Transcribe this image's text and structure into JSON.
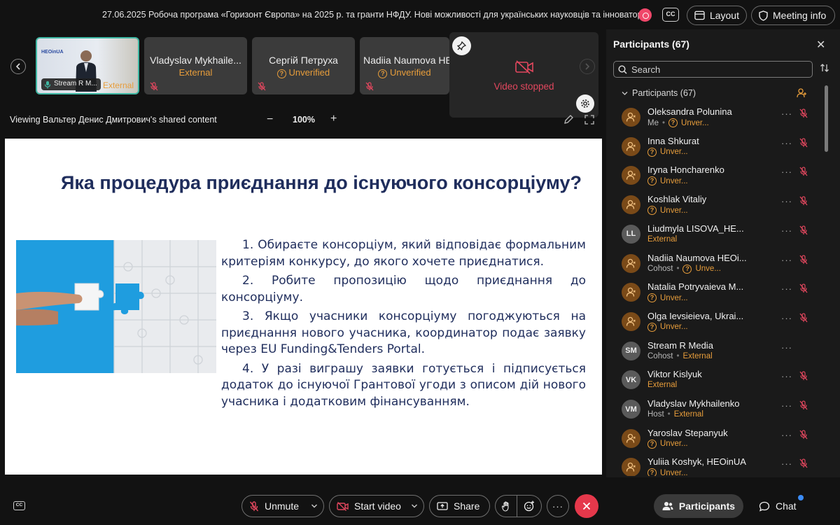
{
  "meeting": {
    "title": "27.06.2025 Робоча програма «Горизонт Європа» на 2025 р. та гранти НФДУ. Нові можливості для українських науковців та інноваторів",
    "cc_label": "CC",
    "layout_label": "Layout",
    "info_label": "Meeting info"
  },
  "thumbnails": [
    {
      "name": "Stream R M...",
      "status": "External",
      "logo": "HEOinUA"
    },
    {
      "name": "Vladyslav Mykhaile...",
      "status": "External"
    },
    {
      "name": "Сергій Петруха",
      "status": "Unverified"
    },
    {
      "name": "Nadiia Naumova HE",
      "status": "Unverified"
    }
  ],
  "self_video": {
    "status": "Video stopped"
  },
  "share": {
    "viewing_text": "Viewing Вальтер Денис Дмитрович's shared content",
    "zoom_level": "100%",
    "zoom_minus": "−",
    "zoom_plus": "+"
  },
  "slide": {
    "title": "Яка процедура приєднання до існуючого консорціуму?",
    "items": [
      "1. Обираєте консорціум, який відповідає формальним критеріям конкурсу, до якого хочете приєднатися.",
      "2. Робите пропозицію щодо приєднання до консорціуму.",
      "3. Якщо учасники консорціуму погоджуються на приєднання нового учасника, координатор подає заявку через EU Funding&Tenders Portal.",
      "4. У разі виграшу заявки готується і підписується додаток до існуючої Грантової угоди з описом дій нового учасника і додатковим фінансуванням."
    ]
  },
  "participants_panel": {
    "title": "Participants (67)",
    "search_placeholder": "Search",
    "group_label": "Participants (67)",
    "list": [
      {
        "name": "Oleksandra Polunina",
        "role": "Me",
        "status": "Unver...",
        "avatar": "icon"
      },
      {
        "name": "Inna Shkurat",
        "role": "",
        "status": "Unver...",
        "avatar": "icon"
      },
      {
        "name": "Iryna Honcharenko",
        "role": "",
        "status": "Unver...",
        "avatar": "icon"
      },
      {
        "name": "Koshlak Vitaliy",
        "role": "",
        "status": "Unver...",
        "avatar": "icon"
      },
      {
        "name": "Liudmyla LISOVA_HE...",
        "role": "",
        "status": "External",
        "avatar": "LL"
      },
      {
        "name": "Nadiia Naumova HEOi...",
        "role": "Cohost",
        "status": "Unve...",
        "avatar": "icon"
      },
      {
        "name": "Natalia Potryvaieva M...",
        "role": "",
        "status": "Unver...",
        "avatar": "icon"
      },
      {
        "name": "Olga Ievsieieva, Ukrai...",
        "role": "",
        "status": "Unver...",
        "avatar": "icon"
      },
      {
        "name": "Stream R Media",
        "role": "Cohost",
        "status": "External",
        "avatar": "SM"
      },
      {
        "name": "Viktor Kislyuk",
        "role": "",
        "status": "External",
        "avatar": "VK"
      },
      {
        "name": "Vladyslav Mykhailenko",
        "role": "Host",
        "status": "External",
        "avatar": "VM"
      },
      {
        "name": "Yaroslav Stepanyuk",
        "role": "",
        "status": "Unver...",
        "avatar": "icon"
      },
      {
        "name": "Yuliia Koshyk, HEOinUA",
        "role": "",
        "status": "Unver...",
        "avatar": "icon"
      }
    ]
  },
  "controls": {
    "unmute": "Unmute",
    "start_video": "Start video",
    "share": "Share",
    "more": "···",
    "participants": "Participants",
    "chat": "Chat"
  },
  "colors": {
    "accent_orange": "#e79d3b",
    "leave_red": "#e5384b",
    "active_tile": "#3fb8a4",
    "video_stopped": "#e2475e"
  }
}
